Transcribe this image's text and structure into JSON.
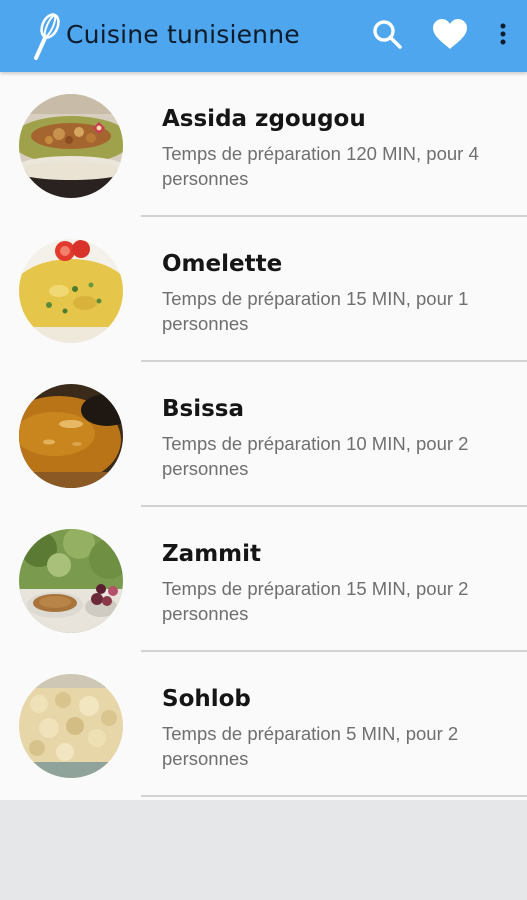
{
  "appbar": {
    "title": "Cuisine tunisienne",
    "logo_icon": "whisk-icon",
    "actions": [
      "search-icon",
      "heart-icon",
      "more-vert-icon"
    ],
    "color": "#4da6ee"
  },
  "recipes": [
    {
      "name": "Assida zgougou",
      "description": "Temps de préparation 120 MIN, pour 4 personnes"
    },
    {
      "name": "Omelette",
      "description": "Temps de préparation 15 MIN, pour 1 personnes"
    },
    {
      "name": "Bsissa",
      "description": "Temps de préparation 10 MIN, pour 2 personnes"
    },
    {
      "name": "Zammit",
      "description": "Temps de préparation 15 MIN, pour 2 personnes"
    },
    {
      "name": "Sohlob",
      "description": "Temps de préparation 5 MIN, pour 2 personnes"
    }
  ]
}
